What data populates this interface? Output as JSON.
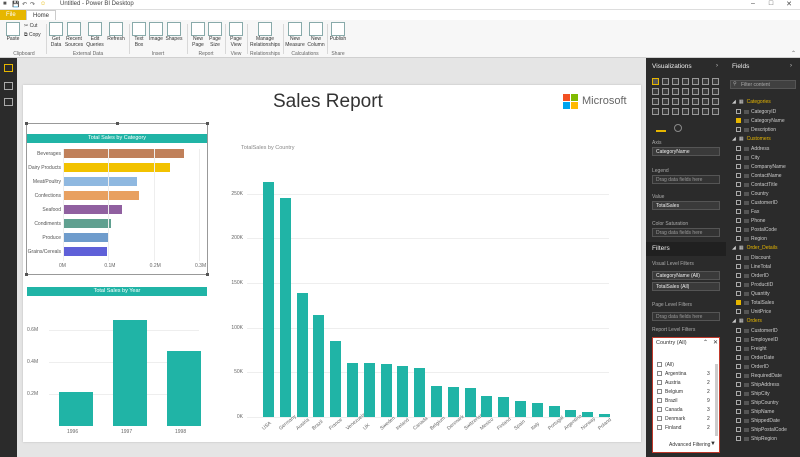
{
  "window": {
    "title": "Untitled - Power BI Desktop"
  },
  "tabs": [
    "File",
    "Home"
  ],
  "ribbon": {
    "buttons": [
      {
        "label": "Paste"
      },
      {
        "label": "Cut"
      },
      {
        "label": "Copy"
      },
      {
        "label": "Get Data"
      },
      {
        "label": "Recent Sources"
      },
      {
        "label": "Edit Queries"
      },
      {
        "label": "Refresh"
      },
      {
        "label": "Text Box"
      },
      {
        "label": "Image"
      },
      {
        "label": "Shapes"
      },
      {
        "label": "New Page"
      },
      {
        "label": "Page Size"
      },
      {
        "label": "Page View"
      },
      {
        "label": "Manage Relationships"
      },
      {
        "label": "New Measure"
      },
      {
        "label": "New Column"
      },
      {
        "label": "Publish"
      }
    ],
    "groups": [
      "Clipboard",
      "External Data",
      "Insert",
      "Report",
      "View",
      "Relationships",
      "Calculations",
      "Share"
    ]
  },
  "report": {
    "title": "Sales Report",
    "logo_text": "Microsoft",
    "logo_colors": [
      "#f25022",
      "#7fba00",
      "#00a4ef",
      "#ffb900"
    ]
  },
  "chart_data": [
    {
      "type": "bar",
      "title": "Total Sales by Category",
      "orientation": "horizontal",
      "categories": [
        "Beverages",
        "Dairy Products",
        "Meat/Poultry",
        "Confections",
        "Seafood",
        "Condiments",
        "Produce",
        "Grains/Cereals"
      ],
      "values": [
        267000,
        235000,
        163000,
        167000,
        131000,
        106000,
        100000,
        96000
      ],
      "colors": [
        "#c0805a",
        "#f2c200",
        "#8fb8e0",
        "#e8a060",
        "#9060a0",
        "#60a090",
        "#6f9ccc",
        "#5f60d8"
      ],
      "xticks": [
        "0M",
        "0.1M",
        "0.2M",
        "0.3M"
      ],
      "xlim": [
        0,
        0.3
      ]
    },
    {
      "type": "bar",
      "title": "Total Sales by Year",
      "categories": [
        "1996",
        "1997",
        "1998"
      ],
      "values": [
        210000,
        660000,
        470000
      ],
      "yticks": [
        "0.2M",
        "0.4M",
        "0.6M"
      ],
      "ylim": [
        0,
        0.7
      ],
      "color": "#20b4a6"
    },
    {
      "type": "bar",
      "title": "TotalSales by Country",
      "categories": [
        "USA",
        "Germany",
        "Austria",
        "Brazil",
        "France",
        "Venezuela",
        "UK",
        "Sweden",
        "Ireland",
        "Canada",
        "Belgium",
        "Denmark",
        "Switzerland",
        "Mexico",
        "Finland",
        "Spain",
        "Italy",
        "Portugal",
        "Argentina",
        "Norway",
        "Poland"
      ],
      "values": [
        263000,
        245000,
        139000,
        114000,
        85000,
        60000,
        60000,
        59000,
        57000,
        55000,
        35000,
        34000,
        32000,
        24000,
        22000,
        18000,
        16000,
        12000,
        8000,
        6000,
        3500
      ],
      "yticks": [
        "0K",
        "50K",
        "100K",
        "150K",
        "200K",
        "250K"
      ],
      "ylim": [
        0,
        280
      ],
      "color": "#20b4a6"
    }
  ],
  "visualizations": {
    "title": "Visualizations",
    "axis_label": "Axis",
    "axis_value": "CategoryName",
    "legend_label": "Legend",
    "legend_placeholder": "Drag data fields here",
    "value_label": "Value",
    "value_value": "TotalSales",
    "color_sat_label": "Color Saturation",
    "color_sat_placeholder": "Drag data fields here",
    "filters_title": "Filters",
    "visual_level_label": "Visual Level Filters",
    "visual_filter_1": "CategoryName (All)",
    "visual_filter_2": "TotalSales (All)",
    "page_level_label": "Page Level Filters",
    "page_level_placeholder": "Drag data fields here",
    "report_level_label": "Report Level Filters",
    "slicer": {
      "header": "Country (All)",
      "items": [
        {
          "name": "(All)",
          "count": ""
        },
        {
          "name": "Argentina",
          "count": "3"
        },
        {
          "name": "Austria",
          "count": "2"
        },
        {
          "name": "Belgium",
          "count": "2"
        },
        {
          "name": "Brazil",
          "count": "9"
        },
        {
          "name": "Canada",
          "count": "3"
        },
        {
          "name": "Denmark",
          "count": "2"
        },
        {
          "name": "Finland",
          "count": "2"
        }
      ],
      "advanced_label": "Advanced Filtering"
    }
  },
  "fields": {
    "title": "Fields",
    "search_placeholder": "Filter content",
    "tables": [
      {
        "name": "Categories",
        "fields": [
          {
            "name": "CategoryID",
            "checked": false
          },
          {
            "name": "CategoryName",
            "checked": true
          },
          {
            "name": "Description",
            "checked": false
          }
        ]
      },
      {
        "name": "Customers",
        "fields": [
          {
            "name": "Address",
            "checked": false
          },
          {
            "name": "City",
            "checked": false
          },
          {
            "name": "CompanyName",
            "checked": false
          },
          {
            "name": "ContactName",
            "checked": false
          },
          {
            "name": "ContactTitle",
            "checked": false
          },
          {
            "name": "Country",
            "checked": false
          },
          {
            "name": "CustomerID",
            "checked": false
          },
          {
            "name": "Fax",
            "checked": false
          },
          {
            "name": "Phone",
            "checked": false
          },
          {
            "name": "PostalCode",
            "checked": false
          },
          {
            "name": "Region",
            "checked": false
          }
        ]
      },
      {
        "name": "Order_Details",
        "fields": [
          {
            "name": "Discount",
            "checked": false
          },
          {
            "name": "LineTotal",
            "checked": false
          },
          {
            "name": "OrderID",
            "checked": false
          },
          {
            "name": "ProductID",
            "checked": false
          },
          {
            "name": "Quantity",
            "checked": false
          },
          {
            "name": "TotalSales",
            "checked": true
          },
          {
            "name": "UnitPrice",
            "checked": false
          }
        ]
      },
      {
        "name": "Orders",
        "fields": [
          {
            "name": "CustomerID",
            "checked": false
          },
          {
            "name": "EmployeeID",
            "checked": false
          },
          {
            "name": "Freight",
            "checked": false
          },
          {
            "name": "OrderDate",
            "checked": false
          },
          {
            "name": "OrderID",
            "checked": false
          },
          {
            "name": "RequiredDate",
            "checked": false
          },
          {
            "name": "ShipAddress",
            "checked": false
          },
          {
            "name": "ShipCity",
            "checked": false
          },
          {
            "name": "ShipCountry",
            "checked": false
          },
          {
            "name": "ShipName",
            "checked": false
          },
          {
            "name": "ShippedDate",
            "checked": false
          },
          {
            "name": "ShipPostalCode",
            "checked": false
          },
          {
            "name": "ShipRegion",
            "checked": false
          }
        ]
      }
    ]
  }
}
